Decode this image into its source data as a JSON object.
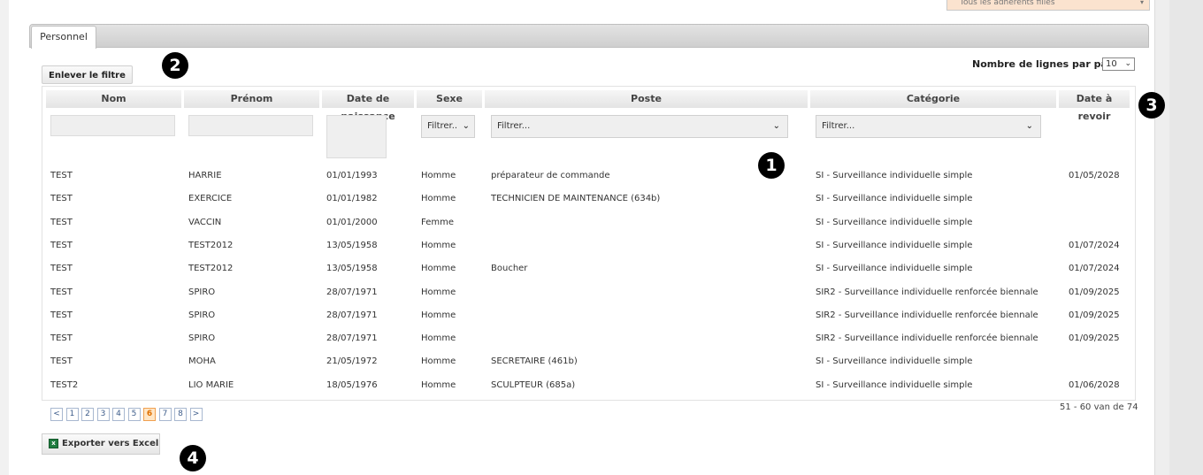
{
  "header_select": {
    "value": "Tous les adhérents filles"
  },
  "tab": {
    "label": "Personnel"
  },
  "toolbar": {
    "remove_filter_label": "Enlever le filtre",
    "rows_per_page_label": "Nombre de lignes par page",
    "rows_per_page_value": "10"
  },
  "columns": {
    "nom": "Nom",
    "prenom": "Prénom",
    "date_naissance": "Date de naissance",
    "sexe": "Sexe",
    "poste": "Poste",
    "categorie": "Catégorie",
    "date_revoir": "Date à revoir"
  },
  "filters": {
    "sexe_placeholder": "Filtrer..",
    "poste_placeholder": "Filtrer...",
    "categorie_placeholder": "Filtrer..."
  },
  "rows": [
    {
      "nom": "TEST",
      "prenom": "HARRIE",
      "date": "01/01/1993",
      "sexe": "Homme",
      "poste": "préparateur de commande",
      "categorie": "SI - Surveillance individuelle simple",
      "revoir": "01/05/2028"
    },
    {
      "nom": "TEST",
      "prenom": "EXERCICE",
      "date": "01/01/1982",
      "sexe": "Homme",
      "poste": "TECHNICIEN DE MAINTENANCE (634b)",
      "categorie": "SI - Surveillance individuelle simple",
      "revoir": ""
    },
    {
      "nom": "TEST",
      "prenom": "VACCIN",
      "date": "01/01/2000",
      "sexe": "Femme",
      "poste": "",
      "categorie": "SI - Surveillance individuelle simple",
      "revoir": ""
    },
    {
      "nom": "TEST",
      "prenom": "TEST2012",
      "date": "13/05/1958",
      "sexe": "Homme",
      "poste": "",
      "categorie": "SI - Surveillance individuelle simple",
      "revoir": "01/07/2024"
    },
    {
      "nom": "TEST",
      "prenom": "TEST2012",
      "date": "13/05/1958",
      "sexe": "Homme",
      "poste": "Boucher",
      "categorie": "SI - Surveillance individuelle simple",
      "revoir": "01/07/2024"
    },
    {
      "nom": "TEST",
      "prenom": "SPIRO",
      "date": "28/07/1971",
      "sexe": "Homme",
      "poste": "",
      "categorie": "SIR2 - Surveillance individuelle renforcée biennale",
      "revoir": "01/09/2025"
    },
    {
      "nom": "TEST",
      "prenom": "SPIRO",
      "date": "28/07/1971",
      "sexe": "Homme",
      "poste": "",
      "categorie": "SIR2 - Surveillance individuelle renforcée biennale",
      "revoir": "01/09/2025"
    },
    {
      "nom": "TEST",
      "prenom": "SPIRO",
      "date": "28/07/1971",
      "sexe": "Homme",
      "poste": "",
      "categorie": "SIR2 - Surveillance individuelle renforcée biennale",
      "revoir": "01/09/2025"
    },
    {
      "nom": "TEST",
      "prenom": "MOHA",
      "date": "21/05/1972",
      "sexe": "Homme",
      "poste": "SECRETAIRE (461b)",
      "categorie": "SI - Surveillance individuelle simple",
      "revoir": ""
    },
    {
      "nom": "TEST2",
      "prenom": "LIO MARIE",
      "date": "18/05/1976",
      "sexe": "Homme",
      "poste": "SCULPTEUR (685a)",
      "categorie": "SI - Surveillance individuelle simple",
      "revoir": "01/06/2028"
    }
  ],
  "pagination": {
    "prev": "<",
    "pages": [
      "1",
      "2",
      "3",
      "4",
      "5",
      "6",
      "7",
      "8"
    ],
    "active_page": "6",
    "next": ">",
    "range_text": "51 - 60 van de 74"
  },
  "export": {
    "label": "Exporter vers Excel",
    "icon": "excel-icon"
  },
  "badges": [
    "1",
    "2",
    "3",
    "4"
  ]
}
